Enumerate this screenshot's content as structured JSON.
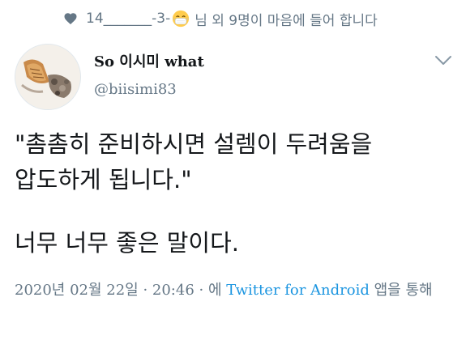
{
  "likes": {
    "icon": "heart-icon",
    "text_before": "14_______-3-",
    "emoji": "face-with-medical-mask",
    "text_after": "님 외 9명이 마음에 들어 합니다"
  },
  "author": {
    "display_name": "So 이시미 what",
    "handle": "@biisimi83"
  },
  "tweet": {
    "quote": "\"촘촘히 준비하시면 설렘이 두려움을\n압도하게 됩니다.\"",
    "closing": "너무 너무 좋은 말이다."
  },
  "meta": {
    "timestamp": "2020년 02월 22일 · 20:46 · 에",
    "source": "Twitter for Android",
    "suffix": "앱을 통해"
  },
  "colors": {
    "text_primary": "#14171a",
    "text_secondary": "#657786",
    "link": "#1b95e0"
  }
}
